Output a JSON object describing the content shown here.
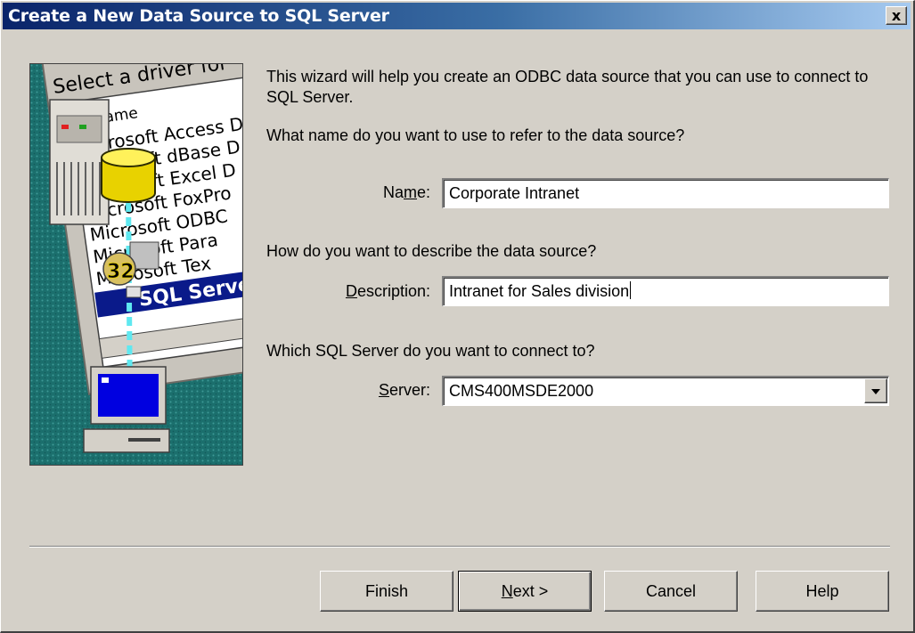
{
  "window": {
    "title": "Create a New Data Source to SQL Server",
    "close_label": "x"
  },
  "intro": "This wizard will help you create an ODBC data source that you can use to connect to SQL Server.",
  "name_question": "What name do you want to use to refer to the data source?",
  "name_field": {
    "label_pre": "Na",
    "label_u": "m",
    "label_post": "e:",
    "value": "Corporate Intranet"
  },
  "description_question": "How do you want to describe the data source?",
  "description_field": {
    "label_u": "D",
    "label_post": "escription:",
    "value": "Intranet for Sales division"
  },
  "server_question": "Which SQL Server do you want to connect to?",
  "server_field": {
    "label_u": "S",
    "label_post": "erver:",
    "value": "CMS400MSDE2000"
  },
  "illustration": {
    "heading": "Select a driver for",
    "column": "Name",
    "drivers": [
      "Microsoft Access D",
      "Microsoft dBase D",
      "Microsoft Excel D",
      "Microsoft FoxPro",
      "Microsoft ODBC",
      "Microsoft Para",
      "Microsoft Tex"
    ],
    "selected": "SQL Server",
    "badge": "32"
  },
  "buttons": {
    "finish": "Finish",
    "next_u": "N",
    "next_post": "ext >",
    "cancel": "Cancel",
    "help": "Help"
  },
  "colors": {
    "title_gradient_start": "#0a246a",
    "title_gradient_end": "#a6caf0",
    "dialog_face": "#d4d0c8",
    "illustration_teal": "#1f7a78"
  }
}
